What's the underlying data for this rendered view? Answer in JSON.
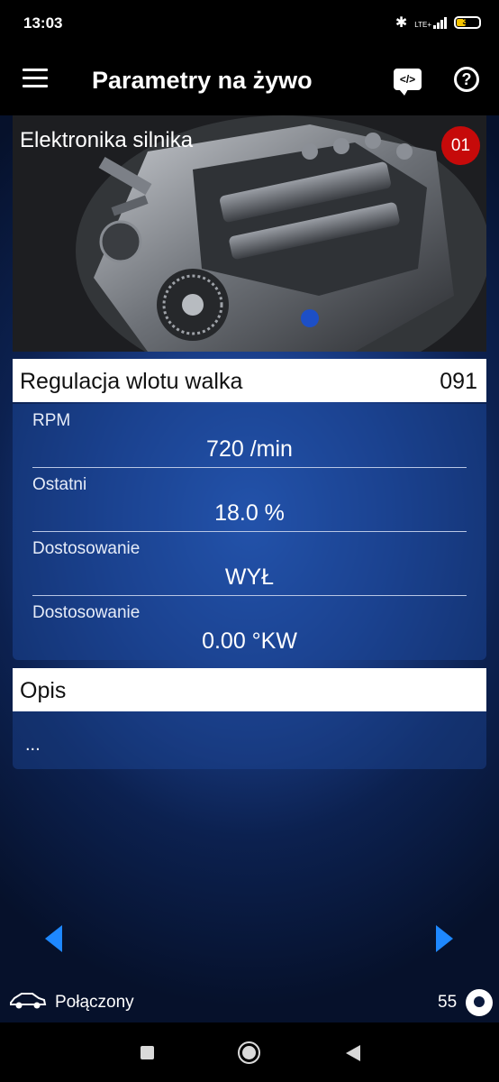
{
  "status_bar": {
    "time": "13:03",
    "network": "LTE+",
    "battery": "33",
    "icons": [
      "bluetooth-icon",
      "signal-icon",
      "battery-icon"
    ]
  },
  "app_bar": {
    "title": "Parametry na żywo",
    "icons": [
      "menu-icon",
      "code-chat-icon",
      "help-icon"
    ]
  },
  "module": {
    "name": "Elektronika silnika",
    "badge": "01"
  },
  "group": {
    "title": "Regulacja wlotu walka",
    "code": "091",
    "params": [
      {
        "label": "RPM",
        "value": "720 /min"
      },
      {
        "label": "Ostatni",
        "value": "18.0 %"
      },
      {
        "label": "Dostosowanie",
        "value": "WYŁ"
      },
      {
        "label": "Dostosowanie",
        "value": "0.00 °KW"
      }
    ]
  },
  "description": {
    "title": "Opis",
    "text": "..."
  },
  "footer": {
    "connection": "Połączony",
    "count": "55"
  },
  "colors": {
    "accent": "#1e88ff",
    "badge": "#c60a0a",
    "battery": "#f5c400"
  }
}
